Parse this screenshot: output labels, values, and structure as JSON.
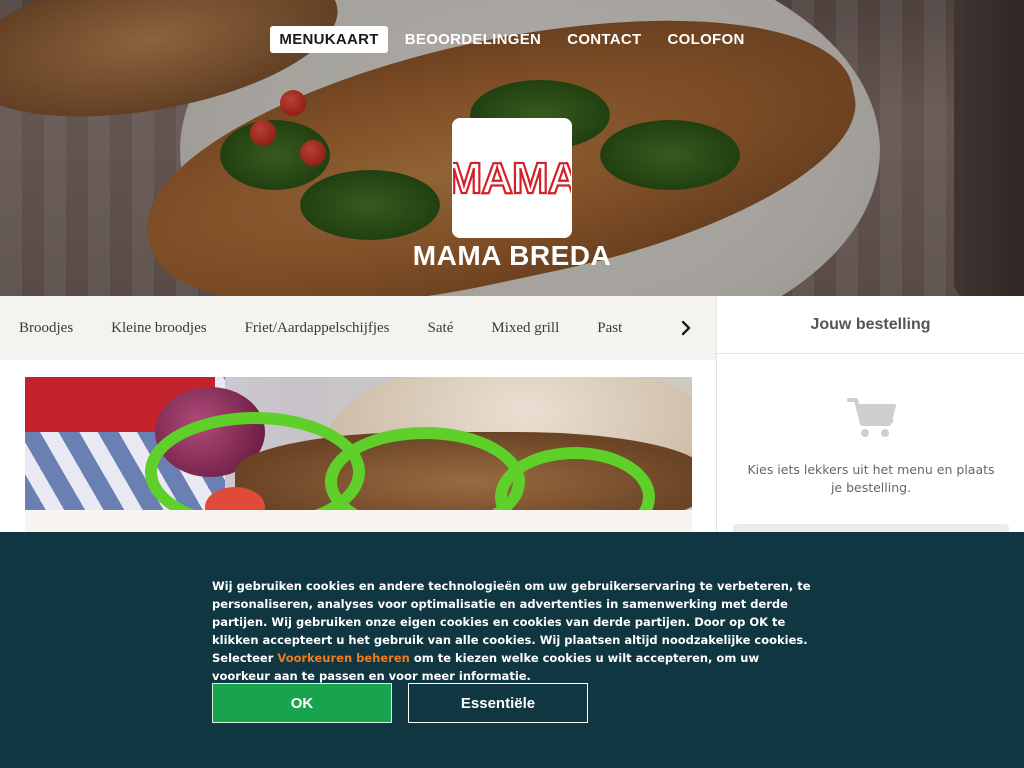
{
  "nav": {
    "items": [
      {
        "label": "MENUKAART",
        "active": true
      },
      {
        "label": "BEOORDELINGEN",
        "active": false
      },
      {
        "label": "CONTACT",
        "active": false
      },
      {
        "label": "COLOFON",
        "active": false
      }
    ]
  },
  "restaurant": {
    "logo_text": "MAMA",
    "name": "MAMA BREDA"
  },
  "categories": [
    "Broodjes",
    "Kleine broodjes",
    "Friet/Aardappelschijfjes",
    "Saté",
    "Mixed grill",
    "Past"
  ],
  "category_next_icon": "chevron-right-icon",
  "order": {
    "title": "Jouw bestelling",
    "empty_icon": "shopping-cart-icon",
    "empty_text": "Kies iets lekkers uit het menu en plaats je bestelling."
  },
  "cookie": {
    "text_before": "Wij gebruiken cookies en andere technologieën om uw gebruikerservaring te verbeteren, te personaliseren, analyses voor optimalisatie en advertenties in samenwerking met derde partijen. Wij gebruiken onze eigen cookies en cookies van derde partijen. Door op OK te klikken accepteert u het gebruik van alle cookies. Wij plaatsen altijd noodzakelijke cookies. Selecteer ",
    "link_text": "Voorkeuren beheren",
    "text_after": " om te kiezen welke cookies u wilt accepteren, om uw voorkeur aan te passen en voor meer informatie.",
    "ok_label": "OK",
    "essential_label": "Essentiële"
  },
  "colors": {
    "cookie_bg": "#0f3641",
    "ok_green": "#18a34e",
    "link_orange": "#f07c1e",
    "logo_red": "#d4202a"
  }
}
